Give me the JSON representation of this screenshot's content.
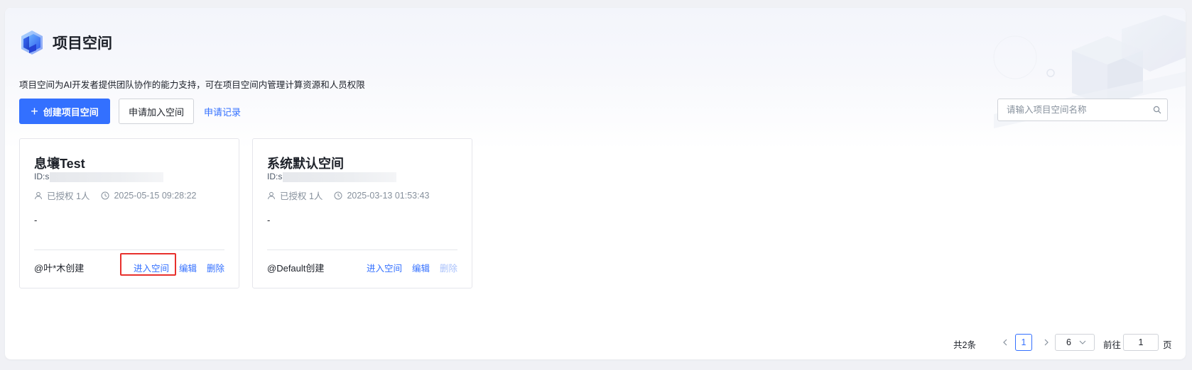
{
  "header": {
    "title": "项目空间",
    "description": "项目空间为AI开发者提供团队协作的能力支持，可在项目空间内管理计算资源和人员权限"
  },
  "toolbar": {
    "create_label": "创建项目空间",
    "join_label": "申请加入空间",
    "records_label": "申请记录"
  },
  "search": {
    "placeholder": "请输入项目空间名称",
    "value": ""
  },
  "cards": [
    {
      "name": "息壤Test",
      "id_prefix": "ID:s",
      "authorized": "已授权 1人",
      "created_time": "2025-05-15 09:28:22",
      "description": "-",
      "creator": "@叶*木创建",
      "actions": {
        "enter": "进入空间",
        "edit": "编辑",
        "delete": "删除"
      }
    },
    {
      "name": "系统默认空间",
      "id_prefix": "ID:s",
      "authorized": "已授权 1人",
      "created_time": "2025-03-13 01:53:43",
      "description": "-",
      "creator": "@Default创建",
      "actions": {
        "enter": "进入空间",
        "edit": "编辑",
        "delete": "删除"
      }
    }
  ],
  "pagination": {
    "total": "共2条",
    "current_page": "1",
    "page_size": "6",
    "goto_label": "前往",
    "goto_value": "1",
    "page_label": "页"
  },
  "colors": {
    "primary": "#3370ff",
    "disabled_link": "#a9c1fb",
    "highlight_border": "#e8302c"
  }
}
